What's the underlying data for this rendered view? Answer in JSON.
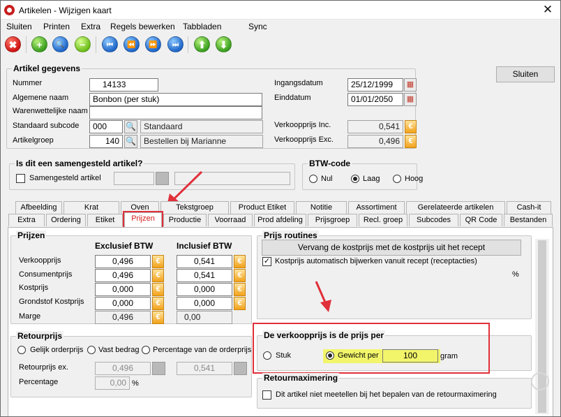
{
  "window": {
    "title": "Artikelen - Wijzigen kaart",
    "close_glyph": "✕"
  },
  "menu": {
    "items": [
      {
        "label": "Sluiten"
      },
      {
        "label": "Printen"
      },
      {
        "label": "Extra"
      },
      {
        "label": "Regels bewerken"
      },
      {
        "label": "Tabbladen"
      },
      {
        "label": "Sync"
      }
    ]
  },
  "toolbar": {
    "buttons": [
      {
        "icon": "cancel-icon",
        "glyph": "✖",
        "color": "red"
      },
      {
        "icon": "add-icon",
        "glyph": "+",
        "color": "green"
      },
      {
        "icon": "search-icon",
        "glyph": "🔍",
        "color": "blue"
      },
      {
        "icon": "remove-icon",
        "glyph": "−",
        "color": "lime"
      },
      {
        "icon": "first-icon",
        "glyph": "⏮",
        "color": "blue"
      },
      {
        "icon": "prev-icon",
        "glyph": "⏪",
        "color": "blue"
      },
      {
        "icon": "next-icon",
        "glyph": "⏩",
        "color": "blue"
      },
      {
        "icon": "last-icon",
        "glyph": "⏭",
        "color": "blue"
      },
      {
        "icon": "up-icon",
        "glyph": "⬆",
        "color": "green"
      },
      {
        "icon": "down-icon",
        "glyph": "⬇",
        "color": "green"
      }
    ]
  },
  "sluiten_button": "Sluiten",
  "artikel": {
    "legend": "Artikel gegevens",
    "nummer_label": "Nummer",
    "nummer": "14133",
    "algemene_naam_label": "Algemene naam",
    "algemene_naam": "Bonbon (per stuk)",
    "warenwet_label": "Warenwettelijke naam",
    "warenwet": "",
    "subcode_label": "Standaard subcode",
    "subcode": "000",
    "subcode_name": "Standaard",
    "artikelgroep_label": "Artikelgroep",
    "artikelgroep": "140",
    "artikelgroep_name": "Bestellen bij Marianne",
    "ingangsdatum_label": "Ingangsdatum",
    "ingangsdatum": "25/12/1999",
    "einddatum_label": "Einddatum",
    "einddatum": "01/01/2050",
    "vp_inc_label": "Verkoopprijs Inc.",
    "vp_inc": "0,541",
    "vp_exc_label": "Verkoopprijs Exc.",
    "vp_exc": "0,496"
  },
  "samengesteld": {
    "legend": "Is dit een samengesteld artikel?",
    "checkbox_label": "Samengesteld artikel"
  },
  "btw": {
    "legend": "BTW-code",
    "options": [
      "Nul",
      "Laag",
      "Hoog"
    ],
    "selected": "Laag"
  },
  "tabs_row1": [
    "Afbeelding",
    "Krat",
    "Oven",
    "Tekstgroep",
    "Product Etiket",
    "Notitie",
    "Assortiment",
    "Gerelateerde artikelen",
    "Cash-it"
  ],
  "tabs_row2": [
    "Extra",
    "Ordering",
    "Etiket",
    "Prijzen",
    "Productie",
    "Voorraad",
    "Prod afdeling",
    "Prijsgroep",
    "Recl. groep",
    "Subcodes",
    "QR Code",
    "Bestanden"
  ],
  "active_tab": "Prijzen",
  "prijzen": {
    "legend": "Prijzen",
    "col_excl": "Exclusief BTW",
    "col_incl": "Inclusief BTW",
    "rows": [
      {
        "label": "Verkoopprijs",
        "excl": "0,496",
        "incl": "0,541"
      },
      {
        "label": "Consumentprijs",
        "excl": "0,496",
        "incl": "0,541"
      },
      {
        "label": "Kostprijs",
        "excl": "0,000",
        "incl": "0,000"
      },
      {
        "label": "Grondstof Kostprijs",
        "excl": "0,000",
        "incl": "0,000"
      },
      {
        "label": "Marge",
        "excl": "0,496",
        "incl": "0,00"
      }
    ]
  },
  "retourprijs": {
    "legend": "Retourprijs",
    "options": [
      "Gelijk orderprijs",
      "Vast bedrag",
      "Percentage van de orderprijs"
    ],
    "ex_label": "Retourprijs ex.",
    "ex_value": "0,496",
    "inc_value": "0,541",
    "percentage_label": "Percentage",
    "percentage": "0,00",
    "percent_sign": "%"
  },
  "prijs_routines": {
    "legend": "Prijs routines",
    "button": "Vervang de kostprijs met de kostprijs uit het recept",
    "checkbox_label": "Kostprijs automatisch bijwerken vanuit recept (receptacties)",
    "percent_sign": "%"
  },
  "verkoopprijs_per": {
    "legend": "De verkoopprijs is de prijs per",
    "stuk_label": "Stuk",
    "gewicht_label": "Gewicht per",
    "gewicht": "100",
    "unit": "gram",
    "selected": "Gewicht per"
  },
  "retourmax": {
    "legend": "Retourmaximering",
    "checkbox_label": "Dit artikel niet meetellen bij het bepalen van de retourmaximering"
  },
  "colors": {
    "highlight": "#e0303a",
    "yellow": "#f2f56a",
    "euro": "#f2a21a"
  }
}
